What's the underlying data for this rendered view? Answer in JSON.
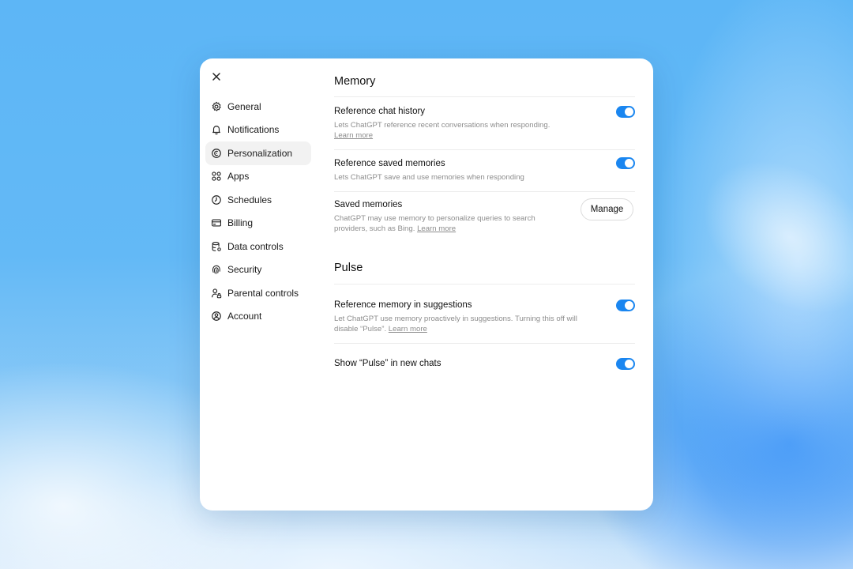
{
  "sidebar": {
    "items": [
      {
        "label": "General",
        "icon": "gear-icon"
      },
      {
        "label": "Notifications",
        "icon": "bell-icon"
      },
      {
        "label": "Personalization",
        "icon": "personalization-icon",
        "active": true
      },
      {
        "label": "Apps",
        "icon": "apps-grid-icon"
      },
      {
        "label": "Schedules",
        "icon": "clock-icon"
      },
      {
        "label": "Billing",
        "icon": "credit-card-icon"
      },
      {
        "label": "Data controls",
        "icon": "database-icon"
      },
      {
        "label": "Security",
        "icon": "fingerprint-icon"
      },
      {
        "label": "Parental controls",
        "icon": "user-lock-icon"
      },
      {
        "label": "Account",
        "icon": "user-circle-icon"
      }
    ]
  },
  "memory": {
    "title": "Memory",
    "reference_chat_history": {
      "title": "Reference chat history",
      "description": "Lets ChatGPT reference recent conversations when responding.",
      "link": "Learn more",
      "enabled": true
    },
    "reference_saved_memories": {
      "title": "Reference saved memories",
      "description": "Lets ChatGPT save and use memories when responding",
      "enabled": true
    },
    "saved_memories": {
      "title": "Saved memories",
      "description": "ChatGPT may use memory to personalize queries to search providers, such as Bing.",
      "link": "Learn more",
      "button": "Manage"
    }
  },
  "pulse": {
    "title": "Pulse",
    "reference_memory_in_suggestions": {
      "title": "Reference memory in suggestions",
      "description": "Let ChatGPT use memory proactively in suggestions. Turning this off will disable “Pulse”.",
      "link": "Learn more",
      "enabled": true
    },
    "show_pulse": {
      "title": "Show “Pulse” in new chats",
      "enabled": true
    }
  },
  "colors": {
    "toggle_on": "#1a86f0",
    "active_nav_bg": "#f2f2f2"
  }
}
